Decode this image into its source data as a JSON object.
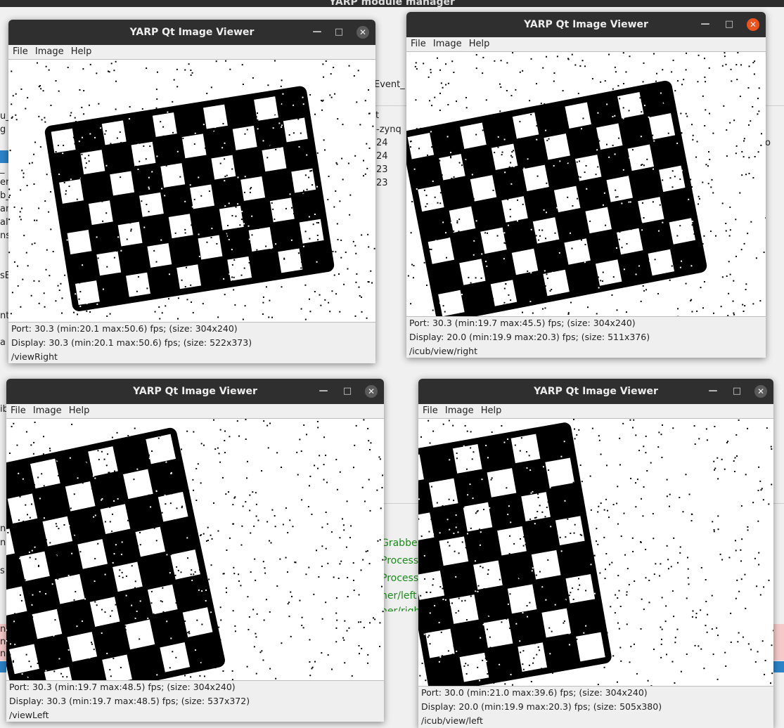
{
  "background_app": {
    "title": "YARP module manager",
    "fragments": {
      "event": "Event_",
      "col_t": "t",
      "zynq": "-zynq",
      "n24a": "24",
      "n24b": "24",
      "n23a": "23",
      "n23b": "23",
      "left_u": "u_",
      "left_g": "g",
      "left_i": "_",
      "left_er": "er",
      "left_b": "b_",
      "left_an": "an",
      "left_alt": "alt",
      "left_ns": "ns",
      "left_se": "sE",
      "left_nt": "nt",
      "left_a": "a",
      "left_ib": "ib",
      "grabber": "Grabber",
      "process1": "Process/",
      "process2": "Process/",
      "ner_left": "ner/left",
      "ner_righ": "ner/righ",
      "right_o": "o",
      "left_nc1": "nc",
      "left_nc2": "nc",
      "left_s": "s",
      "left_n1": "n",
      "left_n2": "n",
      "left_n3": "n"
    }
  },
  "viewers": [
    {
      "id": "view-right",
      "title": "YARP Qt Image Viewer",
      "menu": [
        "File",
        "Image",
        "Help"
      ],
      "port_status": "Port: 30.3 (min:20.1 max:50.6) fps; (size: 304x240)",
      "display_status": "Display: 30.3 (min:20.1 max:50.6) fps; (size: 522x373)",
      "port_name": "/viewRight",
      "close_active": false
    },
    {
      "id": "icub-view-right",
      "title": "YARP Qt Image Viewer",
      "menu": [
        "File",
        "Image",
        "Help"
      ],
      "port_status": "Port: 30.3 (min:19.7 max:45.5) fps; (size: 304x240)",
      "display_status": "Display: 20.0 (min:19.9 max:20.3) fps; (size: 511x376)",
      "port_name": "/icub/view/right",
      "close_active": true
    },
    {
      "id": "view-left",
      "title": "YARP Qt Image Viewer",
      "menu": [
        "File",
        "Image",
        "Help"
      ],
      "port_status": "Port: 30.3 (min:19.7 max:48.5) fps; (size: 304x240)",
      "display_status": "Display: 30.3 (min:19.7 max:48.5) fps; (size: 537x372)",
      "port_name": "/viewLeft",
      "close_active": false
    },
    {
      "id": "icub-view-left",
      "title": "YARP Qt Image Viewer",
      "menu": [
        "File",
        "Image",
        "Help"
      ],
      "port_status": "Port: 30.0 (min:21.0 max:39.6) fps; (size: 304x240)",
      "display_status": "Display: 20.0 (min:19.9 max:20.3) fps; (size: 505x380)",
      "port_name": "/icub/view/left",
      "close_active": false
    }
  ],
  "icons": {
    "minimize": "minimize-icon",
    "maximize": "maximize-icon",
    "close": "close-icon"
  },
  "colors": {
    "titlebar": "#2f2f2f",
    "close_active": "#e9541f",
    "selection_blue": "#2c83c8",
    "error_pink": "#f7caca",
    "link_green": "#1a8c1a"
  }
}
